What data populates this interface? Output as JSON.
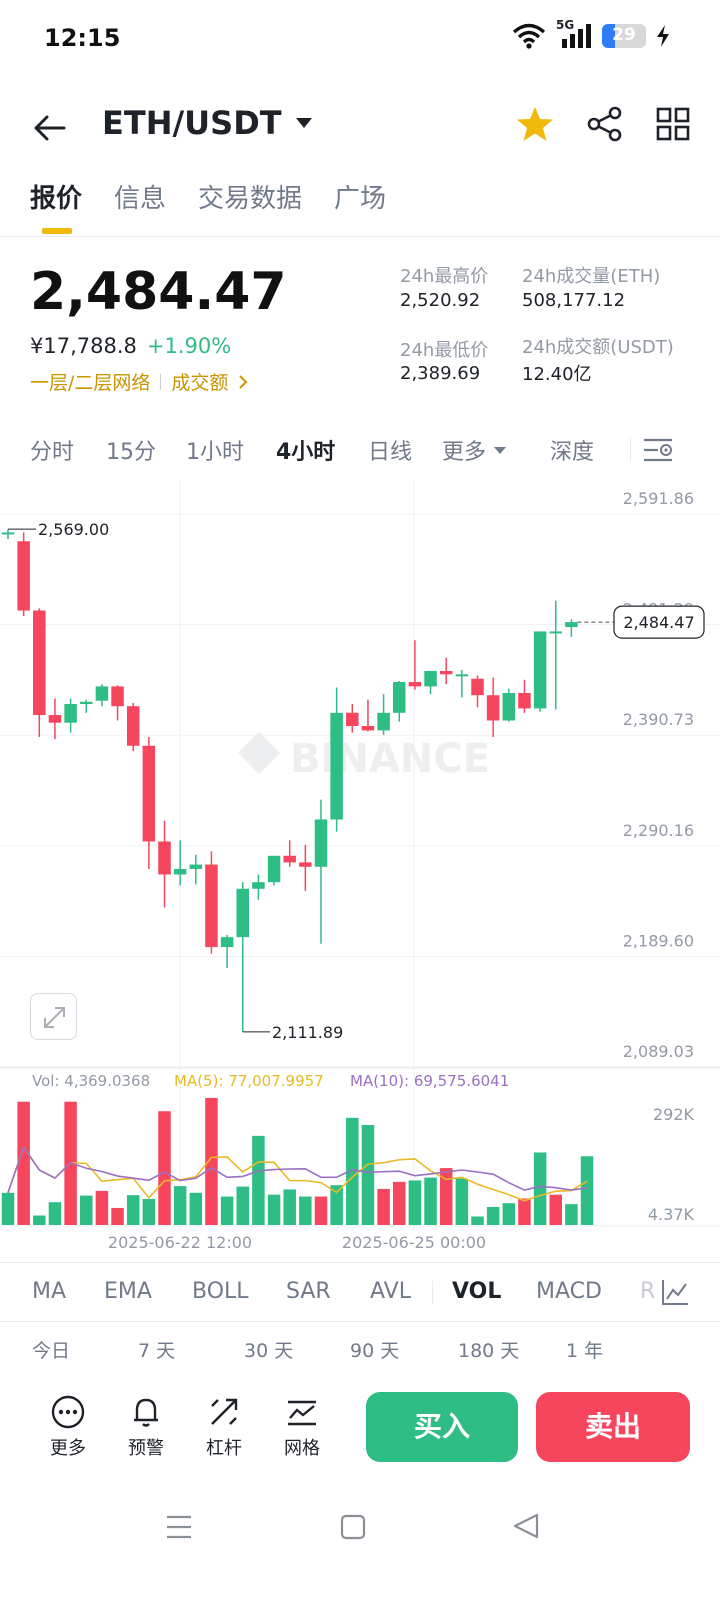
{
  "status": {
    "time": "12:15",
    "network": "5G",
    "battery": "29",
    "battery_level": 0.29
  },
  "header": {
    "pair": "ETH/USDT",
    "icons": [
      "back-arrow-icon",
      "star-icon",
      "share-icon",
      "grid-icon"
    ]
  },
  "tabs": [
    {
      "label": "报价"
    },
    {
      "label": "信息"
    },
    {
      "label": "交易数据"
    },
    {
      "label": "广场"
    }
  ],
  "ticker": {
    "last_price": "2,484.47",
    "cny_price": "¥17,788.8",
    "change_pct": "+1.90%",
    "layer_link": "一层/二层网络",
    "volume_link": "成交额",
    "high_label": "24h最高价",
    "high_value": "2,520.92",
    "low_label": "24h最低价",
    "low_value": "2,389.69",
    "vol_eth_label": "24h成交量(ETH)",
    "vol_eth_value": "508,177.12",
    "vol_usdt_label": "24h成交额(USDT)",
    "vol_usdt_value": "12.40亿"
  },
  "intervals": [
    {
      "label": "分时"
    },
    {
      "label": "15分"
    },
    {
      "label": "1小时"
    },
    {
      "label": "4小时"
    },
    {
      "label": "日线"
    },
    {
      "label": "更多"
    },
    {
      "label": "深度"
    }
  ],
  "chart_data": {
    "type": "candlestick",
    "interval": "4小时",
    "y_ticks": [
      "2,591.86",
      "2,491.29",
      "2,390.73",
      "2,290.16",
      "2,189.60",
      "2,089.03"
    ],
    "ylim": [
      2089.03,
      2591.86
    ],
    "current_price_label": "2,484.47",
    "current_price": 2484.47,
    "high_marker": "2,569.00",
    "high_marker_value": 2569.0,
    "low_marker": "2,111.89",
    "low_marker_value": 2111.89,
    "watermark": "BINANCE",
    "candles": [
      {
        "o": 2565,
        "h": 2569,
        "l": 2560,
        "c": 2566
      },
      {
        "o": 2558,
        "h": 2566,
        "l": 2490,
        "c": 2495
      },
      {
        "o": 2495,
        "h": 2497,
        "l": 2380,
        "c": 2400
      },
      {
        "o": 2400,
        "h": 2415,
        "l": 2378,
        "c": 2393
      },
      {
        "o": 2393,
        "h": 2415,
        "l": 2384,
        "c": 2410
      },
      {
        "o": 2410,
        "h": 2414,
        "l": 2402,
        "c": 2412
      },
      {
        "o": 2413,
        "h": 2428,
        "l": 2408,
        "c": 2426
      },
      {
        "o": 2426,
        "h": 2427,
        "l": 2395,
        "c": 2408
      },
      {
        "o": 2408,
        "h": 2411,
        "l": 2367,
        "c": 2372
      },
      {
        "o": 2372,
        "h": 2380,
        "l": 2260,
        "c": 2285
      },
      {
        "o": 2285,
        "h": 2304,
        "l": 2225,
        "c": 2255
      },
      {
        "o": 2255,
        "h": 2286,
        "l": 2245,
        "c": 2260
      },
      {
        "o": 2260,
        "h": 2273,
        "l": 2246,
        "c": 2264
      },
      {
        "o": 2264,
        "h": 2276,
        "l": 2183,
        "c": 2189
      },
      {
        "o": 2189,
        "h": 2200,
        "l": 2170,
        "c": 2198
      },
      {
        "o": 2198,
        "h": 2248,
        "l": 2111.89,
        "c": 2242
      },
      {
        "o": 2242,
        "h": 2255,
        "l": 2232,
        "c": 2248
      },
      {
        "o": 2248,
        "h": 2268,
        "l": 2245,
        "c": 2272
      },
      {
        "o": 2272,
        "h": 2286,
        "l": 2262,
        "c": 2266
      },
      {
        "o": 2266,
        "h": 2282,
        "l": 2240,
        "c": 2262
      },
      {
        "o": 2262,
        "h": 2323,
        "l": 2192,
        "c": 2305
      },
      {
        "o": 2305,
        "h": 2425,
        "l": 2294,
        "c": 2402
      },
      {
        "o": 2402,
        "h": 2410,
        "l": 2384,
        "c": 2390
      },
      {
        "o": 2390,
        "h": 2414,
        "l": 2385,
        "c": 2386
      },
      {
        "o": 2386,
        "h": 2419,
        "l": 2382,
        "c": 2402
      },
      {
        "o": 2402,
        "h": 2431,
        "l": 2394,
        "c": 2430
      },
      {
        "o": 2430,
        "h": 2468,
        "l": 2423,
        "c": 2426
      },
      {
        "o": 2426,
        "h": 2438,
        "l": 2419,
        "c": 2440
      },
      {
        "o": 2440,
        "h": 2452,
        "l": 2428,
        "c": 2437
      },
      {
        "o": 2437,
        "h": 2441,
        "l": 2416,
        "c": 2437
      },
      {
        "o": 2433,
        "h": 2436,
        "l": 2407,
        "c": 2418
      },
      {
        "o": 2418,
        "h": 2434,
        "l": 2380,
        "c": 2395
      },
      {
        "o": 2395,
        "h": 2424,
        "l": 2394,
        "c": 2420
      },
      {
        "o": 2420,
        "h": 2432,
        "l": 2402,
        "c": 2406
      },
      {
        "o": 2406,
        "h": 2448,
        "l": 2403,
        "c": 2476
      },
      {
        "o": 2476,
        "h": 2504,
        "l": 2405,
        "c": 2476
      },
      {
        "o": 2480,
        "h": 2487,
        "l": 2471,
        "c": 2484.47
      }
    ],
    "x_labels": [
      "2025-06-22 12:00",
      "2025-06-25 00:00"
    ],
    "volume": {
      "label": "Vol: 4,369.0368",
      "ma5_label": "MA(5): 77,007.9957",
      "ma10_label": "MA(10): 69,575.6041",
      "y_ticks": [
        "292K",
        "4.37K"
      ],
      "ylim": [
        4370,
        292000
      ],
      "values": [
        68,
        260,
        20,
        48,
        260,
        62,
        72,
        36,
        63,
        55,
        240,
        82,
        68,
        268,
        60,
        81,
        188,
        64,
        75,
        60,
        60,
        84,
        226,
        211,
        76,
        91,
        94,
        100,
        120,
        98,
        18,
        38,
        46,
        56,
        153,
        64,
        44,
        145
      ],
      "up": [
        true,
        false,
        true,
        true,
        false,
        true,
        false,
        false,
        true,
        true,
        false,
        true,
        true,
        false,
        true,
        true,
        true,
        true,
        true,
        true,
        false,
        true,
        true,
        true,
        false,
        false,
        true,
        true,
        false,
        true,
        true,
        true,
        true,
        false,
        true,
        false,
        true,
        true
      ]
    }
  },
  "indicators": [
    {
      "label": "MA"
    },
    {
      "label": "EMA"
    },
    {
      "label": "BOLL"
    },
    {
      "label": "SAR"
    },
    {
      "label": "AVL"
    },
    {
      "label": "VOL"
    },
    {
      "label": "MACD"
    },
    {
      "label": "R"
    }
  ],
  "performance": [
    {
      "label": "今日"
    },
    {
      "label": "7 天"
    },
    {
      "label": "30 天"
    },
    {
      "label": "90 天"
    },
    {
      "label": "180 天"
    },
    {
      "label": "1 年"
    }
  ],
  "bottom": {
    "more": "更多",
    "alert": "预警",
    "leverage": "杠杆",
    "grid": "网格",
    "buy": "买入",
    "sell": "卖出"
  },
  "colors": {
    "up": "#2ebd85",
    "down": "#f6465d",
    "accent": "#f0b90b",
    "ma5": "#e8b923",
    "ma10": "#9b6fc4"
  }
}
